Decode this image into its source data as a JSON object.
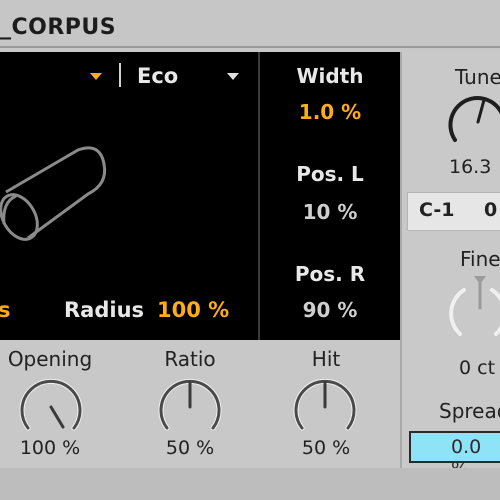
{
  "device": {
    "title": "_CORPUS"
  },
  "resonator": {
    "type_value": "Eco",
    "radius_label": "Radius",
    "radius_value": "100 %",
    "partial_left_text": "s"
  },
  "center_params": {
    "width_label": "Width",
    "width_value": "1.0 %",
    "pos_l_label": "Pos. L",
    "pos_l_value": "10 %",
    "pos_r_label": "Pos. R",
    "pos_r_value": "90 %"
  },
  "bottom_knobs": [
    {
      "label": "Opening",
      "value": "100 %",
      "level": 1.0
    },
    {
      "label": "Ratio",
      "value": "50 %",
      "level": 0.5
    },
    {
      "label": "Hit",
      "value": "50 %",
      "level": 0.5
    }
  ],
  "right_panel": {
    "tune_label": "Tune",
    "tune_value": "16.3",
    "note_value": "C-1",
    "note_value_2": "0",
    "fine_label": "Fine",
    "fine_value": "0 ct",
    "spread_label": "Spread",
    "spread_value": "0.0 %"
  },
  "colors": {
    "accent_orange": "#ffac1c",
    "spread_field": "#8fe3f7",
    "panel_black": "#000000"
  }
}
